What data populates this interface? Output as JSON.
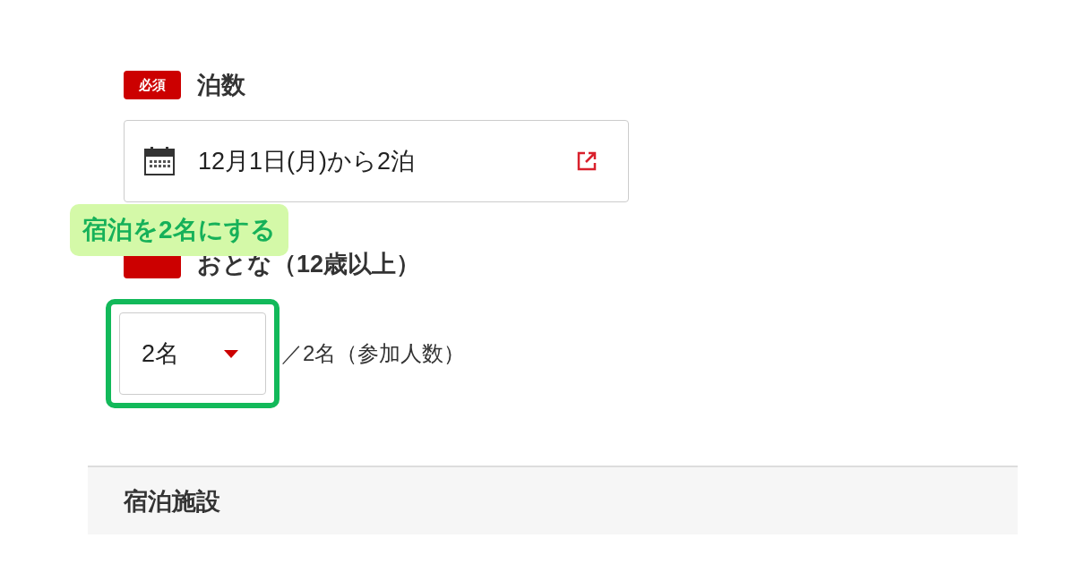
{
  "fields": [
    {
      "kind": "date",
      "required": true,
      "required_label": "必須",
      "label": "泊数",
      "value": "12月1日(月)から2泊"
    },
    {
      "kind": "count",
      "required": true,
      "label": "おとな（12歳以上）",
      "value": "2名",
      "highlighted": true,
      "note": "／2名（参加人数）",
      "callout": "宿泊を2名にする"
    }
  ],
  "section": {
    "title": "宿泊施設"
  }
}
